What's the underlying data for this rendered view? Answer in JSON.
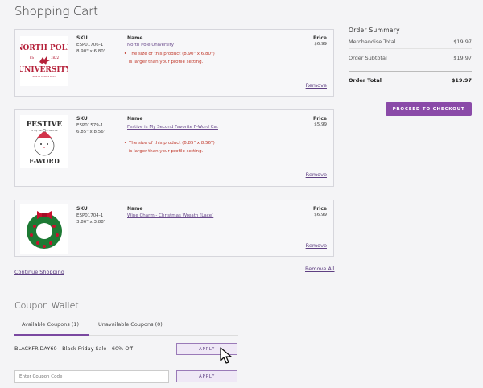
{
  "page": {
    "title": "Shopping Cart"
  },
  "cart": {
    "headers": {
      "sku": "SKU",
      "name": "Name",
      "price": "Price"
    },
    "items": [
      {
        "sku": "ESP01706-1",
        "size": "8.90\" x 6.80\"",
        "name": "North Pole University",
        "price": "$6.99",
        "warning": [
          "The size of this product (8.90\" x 6.80\")",
          "is larger than your profile setting."
        ],
        "remove_label": "Remove"
      },
      {
        "sku": "ESP01579-1",
        "size": "6.85\" x 8.56\"",
        "name": "Festive is My Second Favorite F-Word Cat",
        "price": "$5.99",
        "warning": [
          "The size of this product (6.85\" x 8.56\")",
          "is larger than your profile setting."
        ],
        "remove_label": "Remove"
      },
      {
        "sku": "ESP01704-1",
        "size": "3.86\" x 3.88\"",
        "name": "Wine Charm - Christmas Wreath (Lace)",
        "price": "$6.99",
        "remove_label": "Remove"
      }
    ],
    "continue_label": "Continue Shopping",
    "remove_all_label": "Remove All"
  },
  "summary": {
    "title": "Order Summary",
    "rows": [
      {
        "label": "Merchandise Total",
        "value": "$19.97"
      },
      {
        "label": "Order Subtotal",
        "value": "$19.97"
      }
    ],
    "total": {
      "label": "Order Total",
      "value": "$19.97"
    },
    "checkout_label": "PROCEED TO CHECKOUT"
  },
  "coupons": {
    "title": "Coupon Wallet",
    "tabs": [
      "Available Coupons (1)",
      "Unavailable Coupons (0)"
    ],
    "available": [
      {
        "text": "BLACKFRIDAY60 - Black Friday Sale - 60% Off",
        "apply_label": "APPLY"
      }
    ],
    "input_placeholder": "Enter Coupon Code",
    "input_apply_label": "APPLY"
  },
  "images": {
    "item1": {
      "line1": "NORTH POLE",
      "line2": "UNIVERSITY",
      "est": "EST",
      "year": "1822",
      "tag": "SANTA CLAUS DEPT"
    },
    "item2": {
      "line1": "FESTIVE",
      "line2": "is my Second Favorite",
      "line3": "F-WORD"
    }
  },
  "colors": {
    "accent": "#8a4aa8",
    "warning": "#c0392b",
    "link": "#5e3f82"
  }
}
